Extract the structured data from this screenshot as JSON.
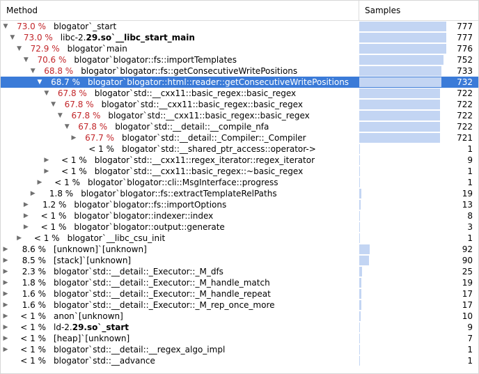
{
  "columns": {
    "method": "Method",
    "samples": "Samples"
  },
  "max_samples": 777,
  "colors": {
    "hot_percent": "#c2262a",
    "selection": "#3b7bd8",
    "bar": "#c3d5f3"
  },
  "rows": [
    {
      "depth": 0,
      "expander": "expanded",
      "percent": "73.0 %",
      "hot": true,
      "parts": [
        {
          "t": "blogator`_start"
        }
      ],
      "samples": 777
    },
    {
      "depth": 1,
      "expander": "expanded",
      "percent": "73.0 %",
      "hot": true,
      "parts": [
        {
          "t": "libc-2."
        },
        {
          "t": "29.so`__libc_start_main",
          "b": true
        }
      ],
      "samples": 777
    },
    {
      "depth": 2,
      "expander": "expanded",
      "percent": "72.9 %",
      "hot": true,
      "parts": [
        {
          "t": "blogator`main"
        }
      ],
      "samples": 776
    },
    {
      "depth": 3,
      "expander": "expanded",
      "percent": "70.6 %",
      "hot": true,
      "parts": [
        {
          "t": "blogator`blogator::fs::importTemplates"
        }
      ],
      "samples": 752
    },
    {
      "depth": 4,
      "expander": "expanded",
      "percent": "68.8 %",
      "hot": true,
      "parts": [
        {
          "t": "blogator`blogator::fs::getConsecutiveWritePositions"
        }
      ],
      "samples": 733
    },
    {
      "depth": 5,
      "expander": "expanded",
      "percent": "68.7 %",
      "hot": true,
      "selected": true,
      "parts": [
        {
          "t": "blogator`blogator::html::reader::getConsecutiveWritePositions"
        }
      ],
      "samples": 732
    },
    {
      "depth": 6,
      "expander": "expanded",
      "percent": "67.8 %",
      "hot": true,
      "parts": [
        {
          "t": "blogator`std::__cxx11::basic_regex::basic_regex"
        }
      ],
      "samples": 722
    },
    {
      "depth": 7,
      "expander": "expanded",
      "percent": "67.8 %",
      "hot": true,
      "parts": [
        {
          "t": "blogator`std::__cxx11::basic_regex::basic_regex"
        }
      ],
      "samples": 722
    },
    {
      "depth": 8,
      "expander": "expanded",
      "percent": "67.8 %",
      "hot": true,
      "parts": [
        {
          "t": "blogator`std::__cxx11::basic_regex::basic_regex"
        }
      ],
      "samples": 722
    },
    {
      "depth": 9,
      "expander": "expanded",
      "percent": "67.8 %",
      "hot": true,
      "parts": [
        {
          "t": "blogator`std::__detail::__compile_nfa"
        }
      ],
      "samples": 722
    },
    {
      "depth": 10,
      "expander": "collapsed",
      "percent": "67.7 %",
      "hot": true,
      "parts": [
        {
          "t": "blogator`std::__detail::_Compiler::_Compiler"
        }
      ],
      "samples": 721
    },
    {
      "depth": 10,
      "expander": "none",
      "percent": "< 1 %",
      "hot": false,
      "parts": [
        {
          "t": "blogator`std::__shared_ptr_access::operator->"
        }
      ],
      "samples": 1
    },
    {
      "depth": 6,
      "expander": "collapsed",
      "percent": "< 1 %",
      "hot": false,
      "parts": [
        {
          "t": "blogator`std::__cxx11::regex_iterator::regex_iterator"
        }
      ],
      "samples": 9
    },
    {
      "depth": 6,
      "expander": "collapsed",
      "percent": "< 1 %",
      "hot": false,
      "parts": [
        {
          "t": "blogator`std::__cxx11::basic_regex::~basic_regex"
        }
      ],
      "samples": 1
    },
    {
      "depth": 5,
      "expander": "collapsed",
      "percent": "< 1 %",
      "hot": false,
      "parts": [
        {
          "t": "blogator`blogator::cli::MsgInterface::progress"
        }
      ],
      "samples": 1
    },
    {
      "depth": 4,
      "expander": "collapsed",
      "percent": "1.8 %",
      "hot": false,
      "parts": [
        {
          "t": "blogator`blogator::fs::extractTemplateRelPaths"
        }
      ],
      "samples": 19
    },
    {
      "depth": 3,
      "expander": "collapsed",
      "percent": "1.2 %",
      "hot": false,
      "parts": [
        {
          "t": "blogator`blogator::fs::importOptions"
        }
      ],
      "samples": 13
    },
    {
      "depth": 3,
      "expander": "collapsed",
      "percent": "< 1 %",
      "hot": false,
      "parts": [
        {
          "t": "blogator`blogator::indexer::index"
        }
      ],
      "samples": 8
    },
    {
      "depth": 3,
      "expander": "collapsed",
      "percent": "< 1 %",
      "hot": false,
      "parts": [
        {
          "t": "blogator`blogator::output::generate"
        }
      ],
      "samples": 3
    },
    {
      "depth": 2,
      "expander": "collapsed",
      "percent": "< 1 %",
      "hot": false,
      "parts": [
        {
          "t": "blogator`__libc_csu_init"
        }
      ],
      "samples": 1
    },
    {
      "depth": 0,
      "expander": "collapsed",
      "percent": "8.6 %",
      "hot": false,
      "parts": [
        {
          "t": "[unknown]`[unknown]"
        }
      ],
      "samples": 92
    },
    {
      "depth": 0,
      "expander": "collapsed",
      "percent": "8.5 %",
      "hot": false,
      "parts": [
        {
          "t": "[stack]`[unknown]"
        }
      ],
      "samples": 90
    },
    {
      "depth": 0,
      "expander": "collapsed",
      "percent": "2.3 %",
      "hot": false,
      "parts": [
        {
          "t": "blogator`std::__detail::_Executor::_M_dfs"
        }
      ],
      "samples": 25
    },
    {
      "depth": 0,
      "expander": "collapsed",
      "percent": "1.8 %",
      "hot": false,
      "parts": [
        {
          "t": "blogator`std::__detail::_Executor::_M_handle_match"
        }
      ],
      "samples": 19
    },
    {
      "depth": 0,
      "expander": "collapsed",
      "percent": "1.6 %",
      "hot": false,
      "parts": [
        {
          "t": "blogator`std::__detail::_Executor::_M_handle_repeat"
        }
      ],
      "samples": 17
    },
    {
      "depth": 0,
      "expander": "collapsed",
      "percent": "1.6 %",
      "hot": false,
      "parts": [
        {
          "t": "blogator`std::__detail::_Executor::_M_rep_once_more"
        }
      ],
      "samples": 17
    },
    {
      "depth": 0,
      "expander": "collapsed",
      "percent": "< 1 %",
      "hot": false,
      "parts": [
        {
          "t": "anon`[unknown]"
        }
      ],
      "samples": 10
    },
    {
      "depth": 0,
      "expander": "collapsed",
      "percent": "< 1 %",
      "hot": false,
      "parts": [
        {
          "t": "ld-2."
        },
        {
          "t": "29.so`_start",
          "b": true
        }
      ],
      "samples": 9
    },
    {
      "depth": 0,
      "expander": "collapsed",
      "percent": "< 1 %",
      "hot": false,
      "parts": [
        {
          "t": "[heap]`[unknown]"
        }
      ],
      "samples": 7
    },
    {
      "depth": 0,
      "expander": "collapsed",
      "percent": "< 1 %",
      "hot": false,
      "parts": [
        {
          "t": "blogator`std::__detail::__regex_algo_impl"
        }
      ],
      "samples": 1
    },
    {
      "depth": 0,
      "expander": "none",
      "percent": "< 1 %",
      "hot": false,
      "parts": [
        {
          "t": "blogator`std::__advance"
        }
      ],
      "samples": 1
    }
  ]
}
